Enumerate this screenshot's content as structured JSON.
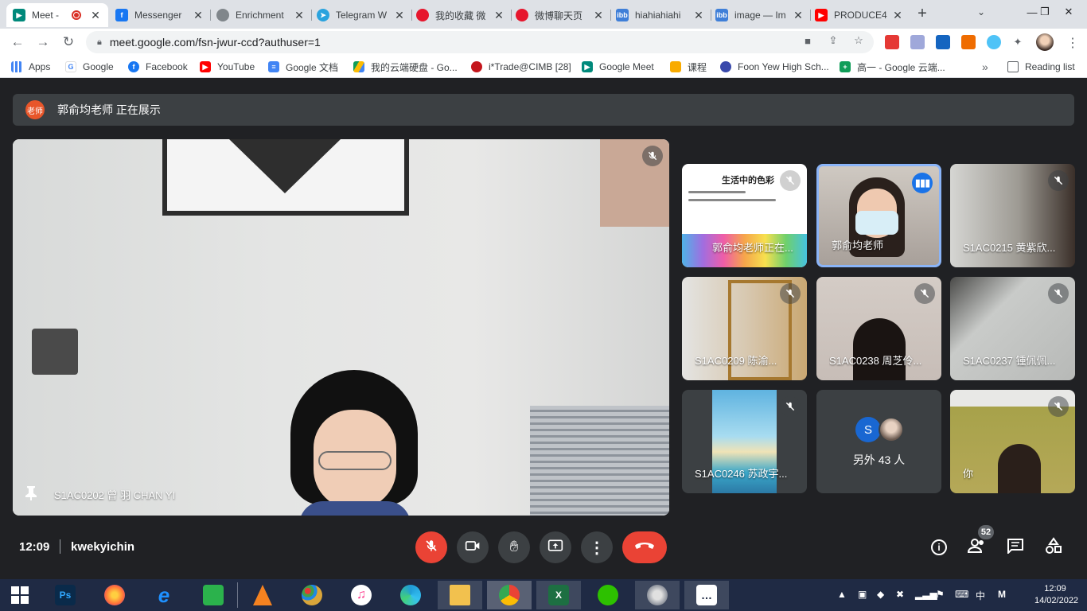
{
  "browser": {
    "tabs": [
      {
        "title": "Meet -",
        "favicon": "google-meet-icon",
        "color": "#00897b",
        "active": true,
        "recording": true
      },
      {
        "title": "Messenger",
        "favicon": "facebook-icon",
        "color": "#1877f2"
      },
      {
        "title": "Enrichment",
        "favicon": "globe-icon",
        "color": "#80868b"
      },
      {
        "title": "Telegram W",
        "favicon": "telegram-icon",
        "color": "#2aa3de"
      },
      {
        "title": "我的收藏 微",
        "favicon": "weibo-icon",
        "color": "#e6162d"
      },
      {
        "title": "微博聊天页",
        "favicon": "weibo-icon",
        "color": "#e6162d"
      },
      {
        "title": "hiahiahiahi",
        "favicon": "ibb-icon",
        "color": "#3f7fd8"
      },
      {
        "title": "image — Im",
        "favicon": "ibb-icon",
        "color": "#3f7fd8"
      },
      {
        "title": "PRODUCE4",
        "favicon": "youtube-icon",
        "color": "#ff0000"
      }
    ],
    "url": "meet.google.com/fsn-jwur-ccd?authuser=1",
    "bookmarks": [
      {
        "label": "Apps",
        "icon": "apps-grid-icon",
        "color": "#4285f4"
      },
      {
        "label": "Google",
        "icon": "google-icon",
        "color": "#4285f4"
      },
      {
        "label": "Facebook",
        "icon": "facebook-icon",
        "color": "#1877f2"
      },
      {
        "label": "YouTube",
        "icon": "youtube-icon",
        "color": "#ff0000"
      },
      {
        "label": "Google 文档",
        "icon": "docs-icon",
        "color": "#4285f4"
      },
      {
        "label": "我的云端硬盘 - Go...",
        "icon": "drive-icon",
        "color": "#fbbc04"
      },
      {
        "label": "i*Trade@CIMB [28]",
        "icon": "cimb-icon",
        "color": "#c4161c"
      },
      {
        "label": "Google Meet",
        "icon": "google-meet-icon",
        "color": "#00897b"
      },
      {
        "label": "课程",
        "icon": "classroom-icon",
        "color": "#f9ab00"
      },
      {
        "label": "Foon Yew High Sch...",
        "icon": "school-icon",
        "color": "#3949ab"
      },
      {
        "label": "高一 - Google 云端...",
        "icon": "sheets-icon",
        "color": "#0f9d58"
      }
    ],
    "reading_list": "Reading list"
  },
  "meet": {
    "presenter_badge": "老师",
    "presenter_text": "郭俞均老师 正在展示",
    "main_tile_name": "S1AC0202 曾 羽 CHAN YI",
    "tiles": [
      {
        "name": "郭俞均老师正在...",
        "type": "slide",
        "muted": true,
        "slide_title": "生活中的色彩"
      },
      {
        "name": "郭俞均老师",
        "type": "camera",
        "speaking": true,
        "bg": "#b9b0a8"
      },
      {
        "name": "S1AC0215 黄紫欣...",
        "type": "camera",
        "muted": true,
        "bg": "#8e8d8a"
      },
      {
        "name": "S1AC0209 陈渝...",
        "type": "camera",
        "muted": true,
        "bg": "#d9cfc1"
      },
      {
        "name": "S1AC0238 周芝伶...",
        "type": "camera",
        "muted": true,
        "bg": "#cfc7c2"
      },
      {
        "name": "S1AC0237 锺佩佩...",
        "type": "camera",
        "muted": true,
        "bg": "#bdbfbd"
      },
      {
        "name": "S1AC0246 苏政宇...",
        "type": "camera",
        "muted": true,
        "bg": "#4fa6d6"
      },
      {
        "name": "另外 43 人",
        "type": "others",
        "avatar_letter": "S"
      },
      {
        "name": "你",
        "type": "camera",
        "muted": true,
        "bg": "#a7a24a"
      }
    ],
    "time": "12:09",
    "meeting_code": "kwekyichin",
    "people_count": "52"
  },
  "taskbar": {
    "time": "12:09",
    "date": "14/02/2022",
    "ime": "中",
    "ime_mode": "M",
    "apps": [
      {
        "name": "photoshop-icon",
        "label": "Ps",
        "color": "#0a2a4a",
        "fg": "#31a8ff"
      },
      {
        "name": "firefox-icon",
        "label": "",
        "color": "#ff7139"
      },
      {
        "name": "ie-icon",
        "label": "e",
        "color": "#1e90ff"
      },
      {
        "name": "store-icon",
        "label": "",
        "color": "#2bb24c"
      },
      {
        "name": "vlc-icon",
        "label": "",
        "color": "#f58220"
      },
      {
        "name": "paint-icon",
        "label": "",
        "color": "#d9a53a"
      },
      {
        "name": "itunes-icon",
        "label": "♫",
        "color": "#fc3c8d"
      },
      {
        "name": "edge-icon",
        "label": "",
        "color": "#1f9bd8"
      },
      {
        "name": "explorer-icon",
        "label": "",
        "color": "#f2c14e"
      },
      {
        "name": "chrome-icon",
        "label": "",
        "color": "#4285f4"
      },
      {
        "name": "excel-icon",
        "label": "X",
        "color": "#1d6f42"
      },
      {
        "name": "wechat-icon",
        "label": "",
        "color": "#2dc100"
      },
      {
        "name": "speaker-app-icon",
        "label": "",
        "color": "#8a8f99"
      },
      {
        "name": "feedback-icon",
        "label": "",
        "color": "#3b4a6b"
      }
    ]
  }
}
